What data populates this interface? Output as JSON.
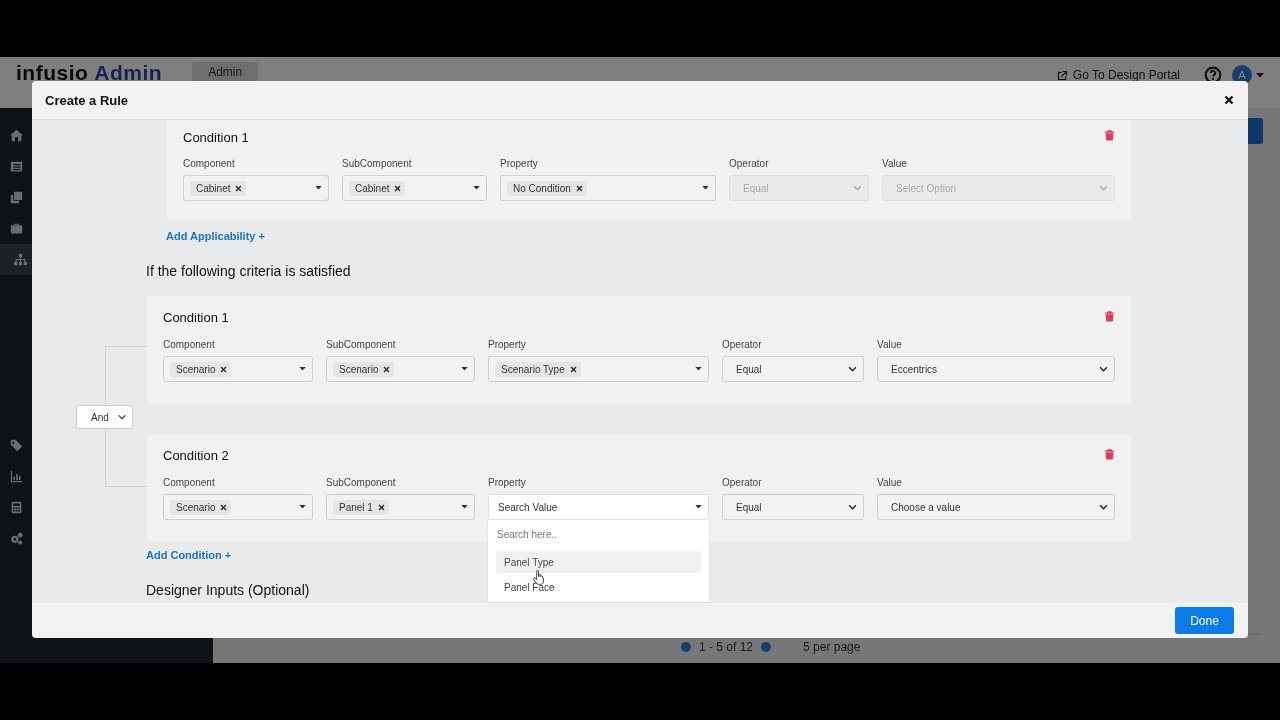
{
  "app": {
    "logo": {
      "name": "infusio",
      "suffix": "Admin"
    },
    "tab": "Admin",
    "portal_link": "Go To Design Portal",
    "avatar": "A",
    "sidebar": {
      "items": [
        {
          "selected": false
        },
        {
          "selected": false
        },
        {
          "selected": false
        },
        {
          "selected": false
        },
        {
          "selected": true
        },
        {
          "selected": false
        },
        {
          "selected": false
        },
        {
          "selected": false
        },
        {
          "selected": false
        }
      ]
    },
    "pagination": {
      "range": "1 - 5 of 12",
      "per_page": "5 per page"
    }
  },
  "dialog": {
    "title": "Create a Rule",
    "applicability": {
      "conditions": [
        {
          "title": "Condition 1",
          "fields": [
            {
              "label": "Component",
              "kind": "tags",
              "tags": [
                "Cabinet"
              ],
              "disabled": false
            },
            {
              "label": "SubComponent",
              "kind": "tags",
              "tags": [
                "Cabinet"
              ],
              "disabled": false
            },
            {
              "label": "Property",
              "kind": "tags",
              "tags": [
                "No Condition"
              ],
              "disabled": false
            },
            {
              "label": "Operator",
              "kind": "select",
              "value": "Equal",
              "disabled": true
            },
            {
              "label": "Value",
              "kind": "select",
              "placeholder": "Select Option",
              "disabled": true
            }
          ]
        }
      ],
      "add_link": "Add Applicability +"
    },
    "criteria": {
      "heading": "If the following criteria is satisfied",
      "joiner": "And",
      "conditions": [
        {
          "title": "Condition 1",
          "fields": [
            {
              "label": "Component",
              "kind": "tags",
              "tags": [
                "Scenario"
              ],
              "disabled": false
            },
            {
              "label": "SubComponent",
              "kind": "tags",
              "tags": [
                "Scenario"
              ],
              "disabled": false
            },
            {
              "label": "Property",
              "kind": "tags",
              "tags": [
                "Scenario Type"
              ],
              "disabled": false
            },
            {
              "label": "Operator",
              "kind": "select",
              "value": "Equal",
              "disabled": false
            },
            {
              "label": "Value",
              "kind": "select",
              "value": "Eccentrics",
              "disabled": false
            }
          ]
        },
        {
          "title": "Condition 2",
          "fields": [
            {
              "label": "Component",
              "kind": "tags",
              "tags": [
                "Scenario"
              ],
              "disabled": false
            },
            {
              "label": "SubComponent",
              "kind": "tags",
              "tags": [
                "Panel 1"
              ],
              "disabled": false
            },
            {
              "label": "Property",
              "kind": "search",
              "placeholder": "Search Value",
              "disabled": false,
              "expanded": true,
              "menu": {
                "search_placeholder": "Search here..",
                "options": [
                  {
                    "label": "Panel Type",
                    "highlighted": true
                  },
                  {
                    "label": "Panel Face",
                    "highlighted": false
                  }
                ]
              }
            },
            {
              "label": "Operator",
              "kind": "select",
              "value": "Equal",
              "disabled": false
            },
            {
              "label": "Value",
              "kind": "select",
              "value": "Choose a value",
              "disabled": false
            }
          ]
        }
      ],
      "add_link": "Add Condition +"
    },
    "designer_heading": "Designer Inputs (Optional)",
    "done_button": "Done"
  }
}
